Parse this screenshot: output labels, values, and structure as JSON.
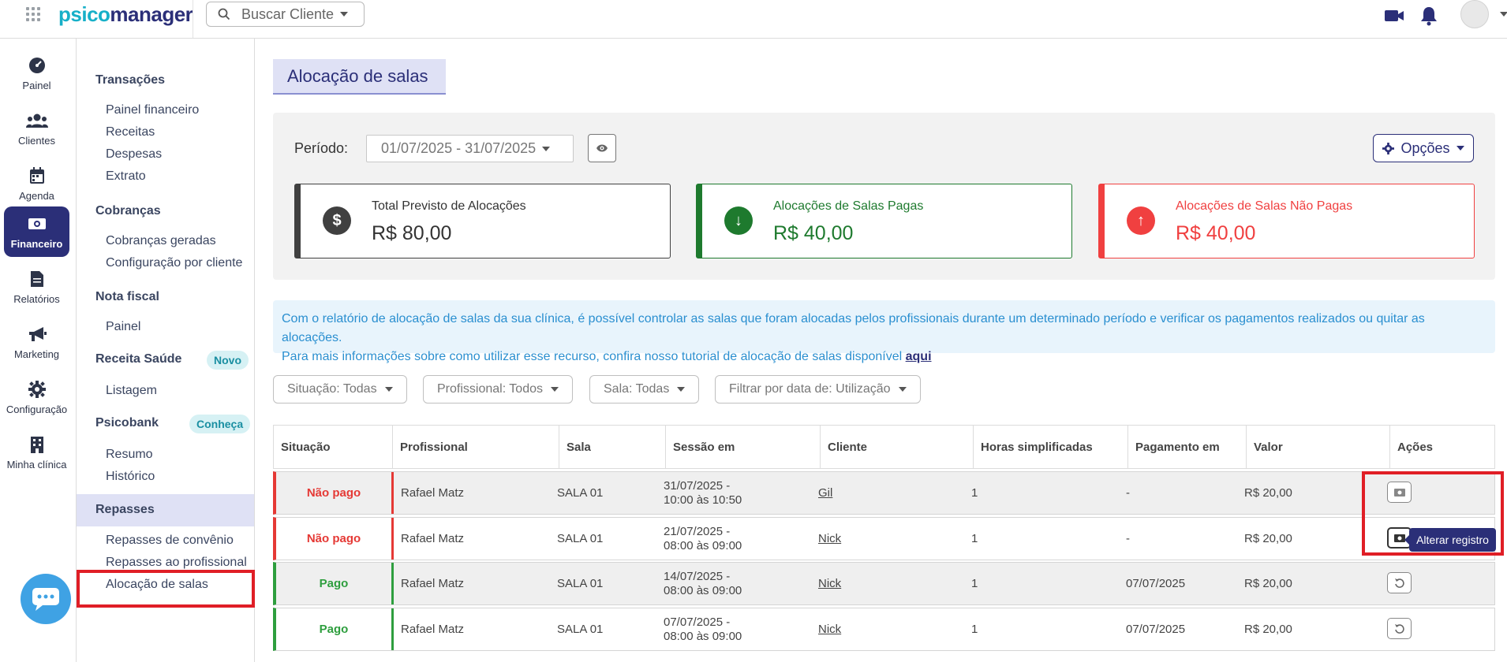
{
  "app": {
    "logo_part1": "psico",
    "logo_part2": "manager",
    "search_label": "Buscar Cliente"
  },
  "rail": [
    {
      "label": "Painel",
      "icon": "dashboard-icon"
    },
    {
      "label": "Clientes",
      "icon": "users-icon"
    },
    {
      "label": "Agenda",
      "icon": "calendar-icon"
    },
    {
      "label": "Financeiro",
      "icon": "money-icon",
      "active": true
    },
    {
      "label": "Relatórios",
      "icon": "document-icon"
    },
    {
      "label": "Marketing",
      "icon": "megaphone-icon"
    },
    {
      "label": "Configuração",
      "icon": "gear-icon"
    },
    {
      "label": "Minha clínica",
      "icon": "building-icon"
    }
  ],
  "subnav": {
    "transacoes": "Transações",
    "painel_financeiro": "Painel financeiro",
    "receitas": "Receitas",
    "despesas": "Despesas",
    "extrato": "Extrato",
    "cobrancas": "Cobranças",
    "cobrancas_geradas": "Cobranças geradas",
    "config_cliente": "Configuração por cliente",
    "nota_fiscal": "Nota fiscal",
    "nf_painel": "Painel",
    "receita_saude": "Receita Saúde",
    "novo_badge": "Novo",
    "listagem": "Listagem",
    "psicobank": "Psicobank",
    "conheca_badge": "Conheça",
    "resumo": "Resumo",
    "historico": "Histórico",
    "repasses": "Repasses",
    "repasses_convenio": "Repasses de convênio",
    "repasses_profissional": "Repasses ao profissional",
    "alocacao_salas": "Alocação de salas"
  },
  "page": {
    "title": "Alocação de salas",
    "period_label": "Período:",
    "period_value": "01/07/2025 - 31/07/2025",
    "options_label": "Opções"
  },
  "cards": [
    {
      "label": "Total Previsto de Alocações",
      "value": "R$ 80,00",
      "color": "#404040",
      "icon": "$"
    },
    {
      "label": "Alocações de Salas Pagas",
      "value": "R$ 40,00",
      "color": "#1e7a2e",
      "icon": "↓"
    },
    {
      "label": "Alocações de Salas Não Pagas",
      "value": "R$ 40,00",
      "color": "#f04040",
      "icon": "↑"
    }
  ],
  "info": {
    "line1": "Com o relatório de alocação de salas da sua clínica, é possível controlar as salas que foram alocadas pelos profissionais durante um determinado período e verificar os pagamentos realizados ou quitar as alocações.",
    "line2": "Para mais informações sobre como utilizar esse recurso, confira nosso tutorial de alocação de salas disponível",
    "link": "aqui"
  },
  "filters": [
    "Situação: Todas",
    "Profissional: Todos",
    "Sala: Todas",
    "Filtrar por data de: Utilização"
  ],
  "table": {
    "headers": [
      "Situação",
      "Profissional",
      "Sala",
      "Sessão em",
      "Cliente",
      "Horas simplificadas",
      "Pagamento em",
      "Valor",
      "Ações"
    ],
    "rows": [
      {
        "situacao": "Não pago",
        "profissional": "Rafael Matz",
        "sala": "SALA 01",
        "sessao_l1": "31/07/2025 -",
        "sessao_l2": "10:00 às 10:50",
        "cliente": "Gil",
        "horas": "1",
        "pagamento": "-",
        "valor": "R$ 20,00",
        "status_color": "#e53935"
      },
      {
        "situacao": "Não pago",
        "profissional": "Rafael Matz",
        "sala": "SALA 01",
        "sessao_l1": "21/07/2025 -",
        "sessao_l2": "08:00 às 09:00",
        "cliente": "Nick",
        "horas": "1",
        "pagamento": "-",
        "valor": "R$ 20,00",
        "status_color": "#e53935"
      },
      {
        "situacao": "Pago",
        "profissional": "Rafael Matz",
        "sala": "SALA 01",
        "sessao_l1": "14/07/2025 -",
        "sessao_l2": "08:00 às 09:00",
        "cliente": "Nick",
        "horas": "1",
        "pagamento": "07/07/2025",
        "valor": "R$ 20,00",
        "status_color": "#2e9e3e"
      },
      {
        "situacao": "Pago",
        "profissional": "Rafael Matz",
        "sala": "SALA 01",
        "sessao_l1": "07/07/2025 -",
        "sessao_l2": "08:00 às 09:00",
        "cliente": "Nick",
        "horas": "1",
        "pagamento": "07/07/2025",
        "valor": "R$ 20,00",
        "status_color": "#2e9e3e"
      }
    ],
    "tooltip": "Alterar registro"
  }
}
